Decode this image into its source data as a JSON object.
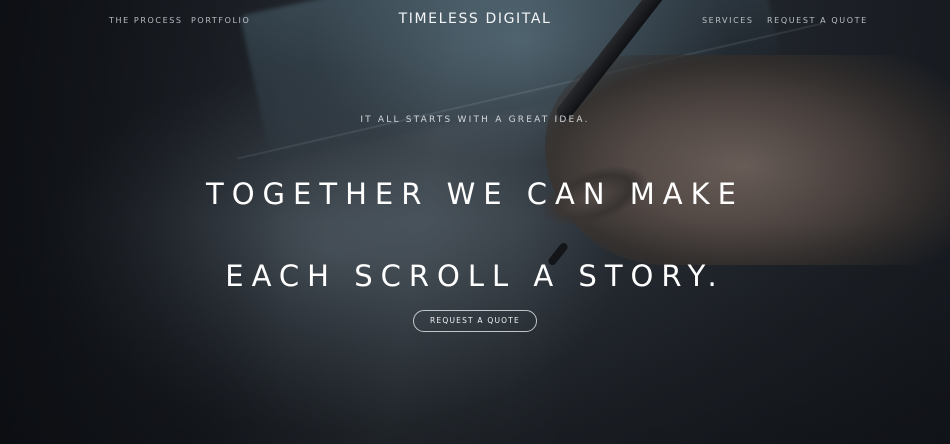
{
  "nav": {
    "left_links": [
      "THE PROCESS",
      "PORTFOLIO"
    ],
    "brand": "TIMELESS DIGITAL",
    "right_links": [
      "SERVICES",
      "REQUEST A QUOTE"
    ]
  },
  "hero": {
    "tagline": "IT ALL STARTS WITH A GREAT IDEA.",
    "headline_line1": "TOGETHER WE CAN MAKE",
    "headline_line2": "EACH SCROLL A STORY.",
    "cta_label": "REQUEST A QUOTE",
    "background": "photo of a hand drawing with a stylus on a tablet, dark blue-grey tones"
  },
  "colors": {
    "text": "#ffffff",
    "background": "#1c2027"
  }
}
